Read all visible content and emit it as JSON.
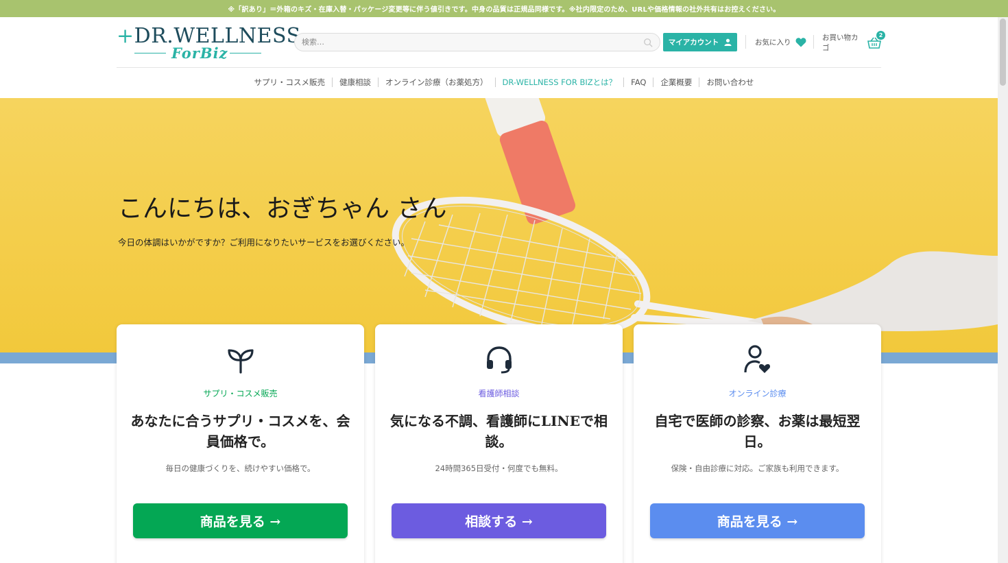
{
  "notice": "※「訳あり」＝外箱のキズ・在庫入替・パッケージ変更等に伴う値引きです。中身の品質は正規品同様です。※社内限定のため、URLや価格情報の社外共有はお控えください。",
  "logo": {
    "main": "DR.WELLNESS",
    "sub": "ForBiz"
  },
  "search": {
    "placeholder": "検索…"
  },
  "header": {
    "account_label": "マイアカウント",
    "favorites_label": "お気に入り",
    "cart_label": "お買い物カゴ",
    "cart_count": "2"
  },
  "nav": {
    "items": [
      {
        "label": "サプリ・コスメ販売"
      },
      {
        "label": "健康相談"
      },
      {
        "label": "オンライン診療（お薬処方）"
      },
      {
        "label": "DR-WELLNESS FOR BIZとは？"
      },
      {
        "label": "FAQ"
      },
      {
        "label": "企業概要"
      },
      {
        "label": "お問い合わせ"
      }
    ]
  },
  "hero": {
    "title": "こんにちは、おぎちゃん さん",
    "subtitle": "今日の体調はいかがですか？ご利用になりたいサービスをお選びください。"
  },
  "cards": [
    {
      "icon": "sprout-icon",
      "category": "サプリ・コスメ販売",
      "heading": "あなたに合うサプリ・コスメを、会員価格で。",
      "description": "毎日の健康づくりを、続けやすい価格で。",
      "button": "商品を見る →",
      "color": "#04a754"
    },
    {
      "icon": "headset-icon",
      "category": "看護師相談",
      "heading": "気になる不調、看護師にLINEで相談。",
      "description": "24時間365日受付・何度でも無料。",
      "button": "相談する →",
      "color": "#6c5ce0"
    },
    {
      "icon": "user-heart-icon",
      "category": "オンライン診療",
      "heading": "自宅で医師の診察、お薬は最短翌日。",
      "description": "保険・自由診療に対応。ご家族も利用できます。",
      "button": "商品を見る →",
      "color": "#5b8def"
    }
  ],
  "colors": {
    "notice_bg": "#a8c36e",
    "brand_teal": "#2ab3a6",
    "hero_yellow": "#f4cd4a",
    "hero_strip": "#7aa8d4"
  }
}
